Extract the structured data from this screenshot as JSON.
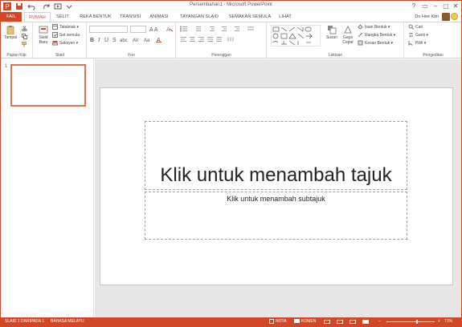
{
  "window": {
    "title": "Persembahan1 - Microsoft PowerPoint",
    "controls": [
      "?",
      "▭",
      "–",
      "▢",
      "✕"
    ]
  },
  "tabs": [
    {
      "label": "FAIL"
    },
    {
      "label": "RUMAH"
    },
    {
      "label": "SELIT"
    },
    {
      "label": "REKA BENTUK"
    },
    {
      "label": "TRANSISI"
    },
    {
      "label": "ANIMASI"
    },
    {
      "label": "TAYANGAN SLAID"
    },
    {
      "label": "SEMAKAN SEMULA"
    },
    {
      "label": "LIHAT"
    }
  ],
  "user": {
    "name": "Do Hee Kim"
  },
  "ribbon": {
    "clipboard": {
      "label": "Papan Klip",
      "paste": "Tampal"
    },
    "slides": {
      "label": "Slaid",
      "new_slide_1": "Slaid",
      "new_slide_2": "Baru",
      "layout": "Tataletak",
      "reset": "Set semula",
      "section": "Seksyen"
    },
    "font": {
      "label": "Fon"
    },
    "paragraph": {
      "label": "Perenggan"
    },
    "drawing": {
      "label": "Lukisan",
      "arrange": "Susun",
      "quick_styles_1": "Gaya",
      "quick_styles_2": "Cepat",
      "shape_fill": "Isian Bentuk",
      "shape_outline": "Rangka Bentuk",
      "shape_effects": "Kesan Bentuk"
    },
    "editing": {
      "label": "Pengeditan",
      "find": "Cari",
      "replace": "Ganti",
      "select": "Pilih"
    }
  },
  "thumbnail": {
    "number": "1"
  },
  "slide": {
    "title_placeholder": "Klik untuk menambah tajuk",
    "subtitle_placeholder": "Klik untuk menambah subtajuk"
  },
  "status": {
    "slide_info": "SLAID 1 DARIPADA 1",
    "language": "BAHASA MELAYU",
    "notes": "NOTA",
    "comments": "KOMEN",
    "zoom": "71%"
  },
  "colors": {
    "accent": "#d24726"
  }
}
